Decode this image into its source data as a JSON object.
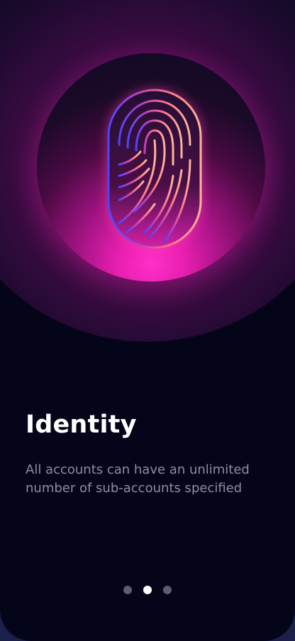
{
  "onboarding": {
    "illustration_icon": "fingerprint-icon",
    "title": "Identity",
    "description": "All accounts can have an unlimited number of sub-accounts specified"
  },
  "pager": {
    "total_pages": 3,
    "current_page": 2
  },
  "colors": {
    "background": "#05051a",
    "glow_magenta": "#ff2fc9",
    "fingerprint_blue": "#4a46ff",
    "fingerprint_coral": "#ff8a7a",
    "title_text": "#ffffff",
    "body_text": "#8e8f9b",
    "dot_active": "#ffffff",
    "dot_inactive": "#5d5e6c"
  }
}
